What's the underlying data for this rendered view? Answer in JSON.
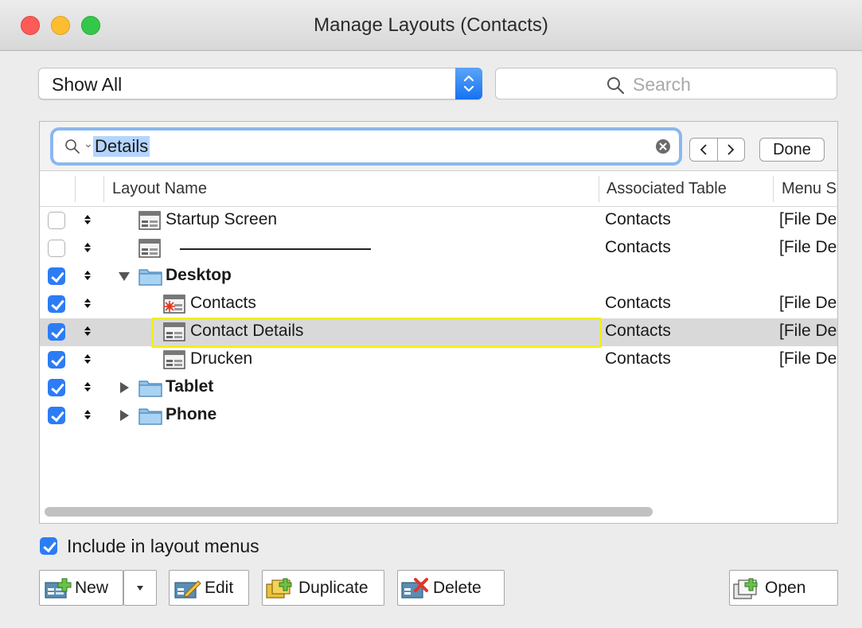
{
  "window": {
    "title": "Manage Layouts (Contacts)"
  },
  "filter": {
    "selected": "Show All"
  },
  "search": {
    "placeholder": "Search"
  },
  "find": {
    "query": "Details",
    "done_label": "Done"
  },
  "columns": {
    "layout_name": "Layout Name",
    "associated_table": "Associated Table",
    "menu_set": "Menu S"
  },
  "rows": [
    {
      "name": "Startup Screen",
      "table": "Contacts",
      "menu": "[File De",
      "checked": false,
      "type": "layout",
      "indent": 0
    },
    {
      "name": "———————————",
      "table": "Contacts",
      "menu": "[File De",
      "checked": false,
      "type": "separator",
      "indent": 0
    },
    {
      "name": "Desktop",
      "table": "",
      "menu": "",
      "checked": true,
      "type": "folder-open",
      "indent": 0
    },
    {
      "name": "Contacts",
      "table": "Contacts",
      "menu": "[File De",
      "checked": true,
      "type": "layout-start",
      "indent": 1
    },
    {
      "name": "Contact Details",
      "table": "Contacts",
      "menu": "[File De",
      "checked": true,
      "type": "layout",
      "indent": 1,
      "selected": true
    },
    {
      "name": "Drucken",
      "table": "Contacts",
      "menu": "[File De",
      "checked": true,
      "type": "layout",
      "indent": 1
    },
    {
      "name": "Tablet",
      "table": "",
      "menu": "",
      "checked": true,
      "type": "folder-closed",
      "indent": 0
    },
    {
      "name": "Phone",
      "table": "",
      "menu": "",
      "checked": true,
      "type": "folder-closed",
      "indent": 0
    }
  ],
  "include_option": {
    "label": "Include in layout menus",
    "checked": true
  },
  "buttons": {
    "new": "New",
    "edit": "Edit",
    "duplicate": "Duplicate",
    "delete": "Delete",
    "open": "Open"
  },
  "colors": {
    "accent": "#2c7cf6",
    "highlight": "#f2ef13",
    "selected_row": "#d9d9d9"
  }
}
